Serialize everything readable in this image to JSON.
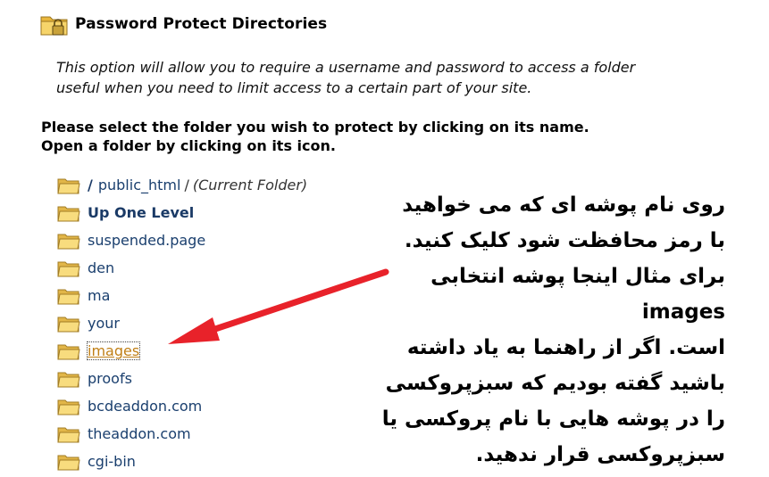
{
  "header": {
    "title": "Password Protect Directories",
    "icon": "folder-lock-icon"
  },
  "description": {
    "line1": "This option will allow you to require a username and password to access a folder",
    "line2": "useful when you need to limit access to a certain part of your site."
  },
  "instructions": {
    "line1": "Please select the folder you wish to protect by clicking on its name.",
    "line2": "Open a folder by clicking on its icon."
  },
  "folders": {
    "current": {
      "root": "/",
      "name": "public_html",
      "sep": "/",
      "note": "(Current Folder)"
    },
    "items": [
      {
        "label": "Up One Level"
      },
      {
        "label": "suspended.page"
      },
      {
        "label": "den"
      },
      {
        "label": "ma"
      },
      {
        "label": "your"
      },
      {
        "label": "images"
      },
      {
        "label": "proofs"
      },
      {
        "label": "bcdeaddon.com"
      },
      {
        "label": "theaddon.com"
      },
      {
        "label": "cgi-bin"
      }
    ],
    "selected": "images"
  },
  "annotation": {
    "lines": [
      "روی نام پوشه ای که می خواهید",
      "با رمز محافظت شود کلیک کنید.",
      "برای مثال اینجا پوشه انتخابی",
      "images",
      "است. اگر از راهنما به یاد داشته",
      "باشید گفته بودیم که سبزپروکسی",
      "را در پوشه هایی با نام پروکسی یا",
      "سبزپروکسی قرار ندهید."
    ],
    "arrow_color": "#e8222a"
  },
  "colors": {
    "link": "#1a3f6e",
    "selected_link": "#c07f16",
    "folder_yellow": "#f2d36b"
  }
}
